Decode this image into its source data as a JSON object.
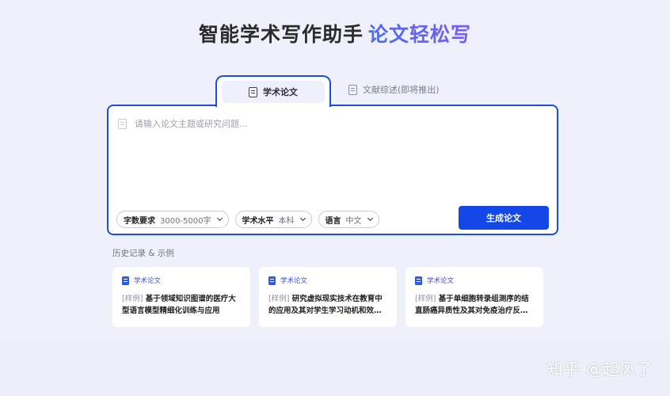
{
  "header": {
    "title_main": "智能学术写作助手",
    "title_accent": "论文轻松写"
  },
  "tabs": [
    {
      "label": "学术论文",
      "icon": "document-icon",
      "active": true
    },
    {
      "label": "文献综述(即将推出)",
      "icon": "document-icon",
      "active": false
    }
  ],
  "editor": {
    "placeholder": "请输入论文主题或研究问题...",
    "value": ""
  },
  "controls": {
    "word_count": {
      "label": "字数要求",
      "value": "3000-5000字"
    },
    "level": {
      "label": "学术水平",
      "value": "本科"
    },
    "language": {
      "label": "语言",
      "value": "中文"
    },
    "generate_label": "生成论文"
  },
  "history": {
    "title": "历史记录 & 示例",
    "cards": [
      {
        "tag": "学术论文",
        "prefix": "[样例]",
        "text": "基于领域知识图谱的医疗大型语言模型精细化训练与应用"
      },
      {
        "tag": "学术论文",
        "prefix": "[样例]",
        "text": "研究虚拟现实技术在教育中的应用及其对学生学习动机和效果的影响"
      },
      {
        "tag": "学术论文",
        "prefix": "[样例]",
        "text": "基于单细胞转录组测序的结直肠癌异质性及其对免疫治疗反应的影响"
      }
    ]
  },
  "watermark": "知乎 @起风了",
  "colors": {
    "accent": "#1d4ed8",
    "button": "#1347e8",
    "background": "#eef0fb"
  }
}
